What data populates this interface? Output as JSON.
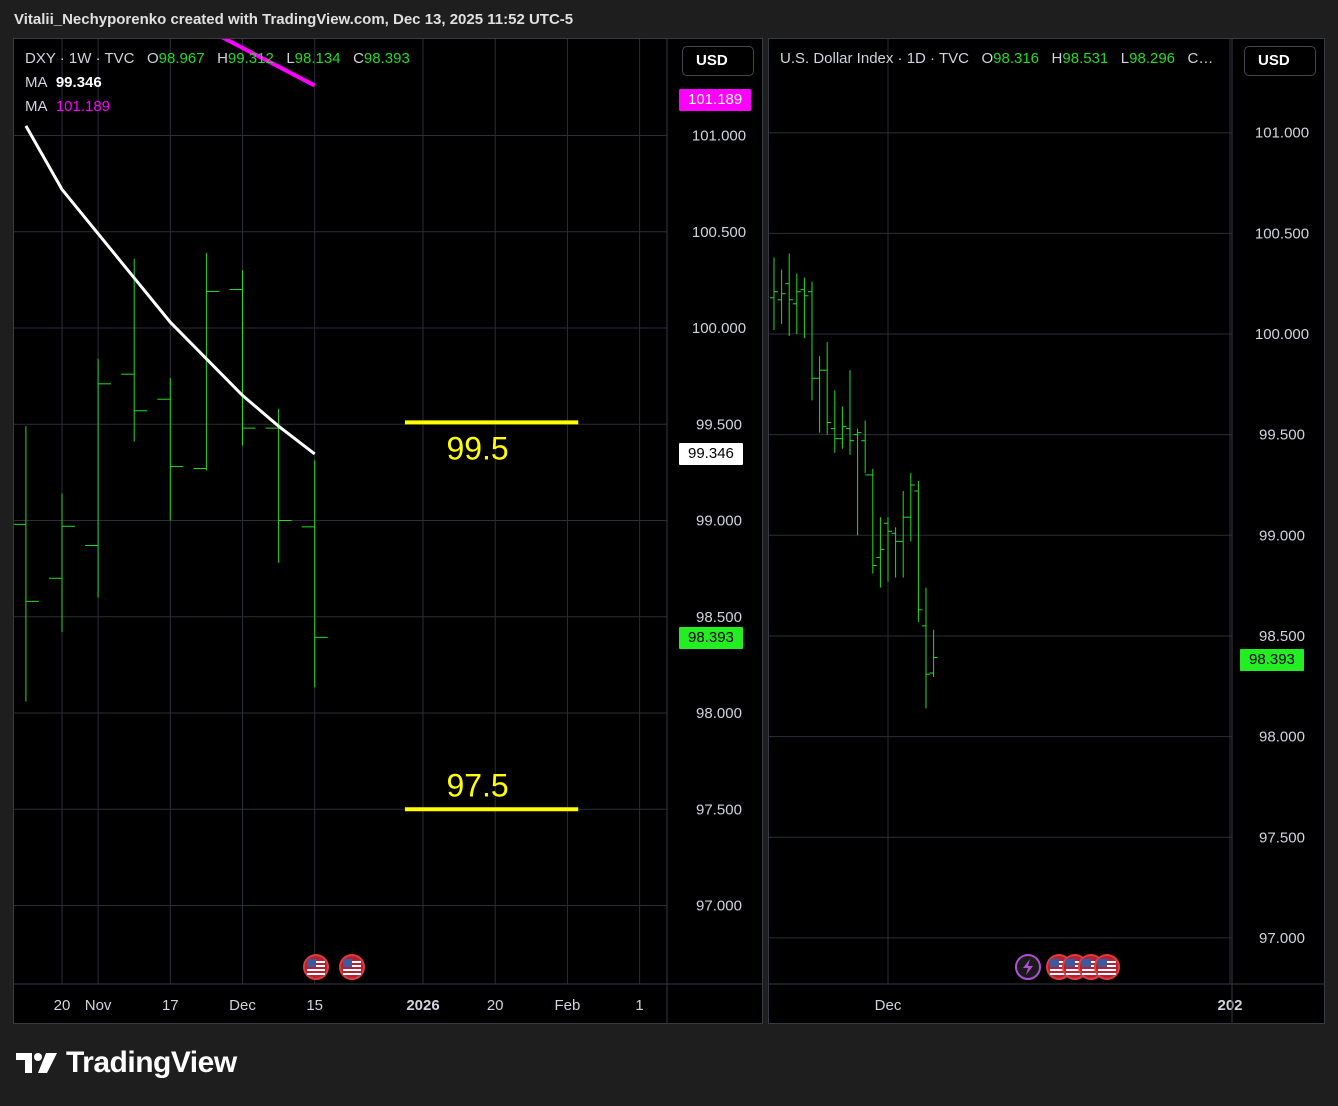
{
  "header": {
    "text": "Vitalii_Nechyporenko created with TradingView.com, Dec 13, 2025 11:52 UTC-5"
  },
  "brand": {
    "name": "TradingView",
    "icon": "tradingview-logo-icon"
  },
  "colors": {
    "up": "#22dd22",
    "ma_fast": "#ffffff",
    "ma_slow": "#ff00ff",
    "level": "#ffff00",
    "grid": "#2a2e39",
    "bg": "#000000"
  },
  "left": {
    "legend": {
      "symbol": "DXY · 1W · TVC",
      "o_label": "O",
      "o": "98.967",
      "h_label": "H",
      "h": "99.312",
      "l_label": "L",
      "l": "98.134",
      "c_label": "C",
      "c": "98.393"
    },
    "ma1": {
      "label": "MA",
      "value": "99.346",
      "color": "#ffffff"
    },
    "ma2": {
      "label": "MA",
      "value": "101.189",
      "color": "#ff00ff"
    },
    "currency": "USD",
    "tags": {
      "ma2": "101.189",
      "ma1": "99.346",
      "last": "98.393"
    },
    "level_labels": {
      "upper": "99.5",
      "lower": "97.5"
    },
    "event_icons": [
      "us-flag-icon",
      "us-flag-icon"
    ]
  },
  "right": {
    "legend": {
      "symbol": "U.S. Dollar Index · 1D · TVC",
      "o_label": "O",
      "o": "98.316",
      "h_label": "H",
      "h": "98.531",
      "l_label": "L",
      "l": "98.296",
      "c_label": "C…",
      "c": ""
    },
    "currency": "USD",
    "tags": {
      "last": "98.393"
    },
    "event_icons": [
      "lightning-icon",
      "us-flag-icon",
      "us-flag-icon",
      "us-flag-icon",
      "us-flag-icon"
    ]
  },
  "chart_data": [
    {
      "type": "ohlc",
      "title": "DXY · 1W · TVC",
      "ylim": [
        96.7,
        101.7
      ],
      "y_ticks": [
        "101.000",
        "100.500",
        "100.000",
        "99.500",
        "99.000",
        "98.500",
        "98.000",
        "97.500",
        "97.000"
      ],
      "y_tick_values": [
        101.0,
        100.5,
        100.0,
        99.5,
        99.0,
        98.5,
        98.0,
        97.5,
        97.0
      ],
      "x_ticks": [
        "20",
        "Nov",
        "17",
        "Dec",
        "15",
        "2026",
        "20",
        "Feb",
        "1"
      ],
      "x_tick_bold": [
        false,
        false,
        false,
        false,
        false,
        true,
        false,
        false,
        false
      ],
      "x_tick_week_index": [
        0,
        1,
        3,
        5,
        7,
        10,
        12,
        14,
        16
      ],
      "bars": [
        {
          "w": -1,
          "o": 98.98,
          "h": 99.49,
          "l": 98.06,
          "c": 98.58
        },
        {
          "w": 0,
          "o": 98.7,
          "h": 99.14,
          "l": 98.42,
          "c": 98.97
        },
        {
          "w": 1,
          "o": 98.87,
          "h": 99.84,
          "l": 98.6,
          "c": 99.71
        },
        {
          "w": 2,
          "o": 99.76,
          "h": 100.36,
          "l": 99.41,
          "c": 99.57
        },
        {
          "w": 3,
          "o": 99.63,
          "h": 99.74,
          "l": 99.0,
          "c": 99.28
        },
        {
          "w": 4,
          "o": 99.27,
          "h": 100.39,
          "l": 99.26,
          "c": 100.19
        },
        {
          "w": 5,
          "o": 100.2,
          "h": 100.3,
          "l": 99.39,
          "c": 99.48
        },
        {
          "w": 6,
          "o": 99.48,
          "h": 99.58,
          "l": 98.78,
          "c": 99.0
        },
        {
          "w": 7,
          "o": 98.967,
          "h": 99.312,
          "l": 98.134,
          "c": 98.393
        }
      ],
      "ma_fast": {
        "name": "MA",
        "w": [
          -1,
          0,
          1,
          2,
          3,
          4,
          5,
          6,
          7
        ],
        "values": [
          101.05,
          100.72,
          100.49,
          100.26,
          100.03,
          99.84,
          99.65,
          99.49,
          99.346
        ]
      },
      "ma_slow": {
        "name": "MA",
        "w": [
          2.7,
          7
        ],
        "values": [
          101.68,
          101.26
        ]
      },
      "levels": [
        {
          "label": "99.5",
          "value": 99.51,
          "w_start": 9.5,
          "w_end": 14.3
        },
        {
          "label": "97.5",
          "value": 97.5,
          "w_start": 9.5,
          "w_end": 14.3
        }
      ]
    },
    {
      "type": "ohlc",
      "title": "U.S. Dollar Index · 1D · TVC",
      "ylim": [
        96.7,
        101.7
      ],
      "y_ticks": [
        "101.000",
        "100.500",
        "100.000",
        "99.500",
        "99.000",
        "98.500",
        "98.000",
        "97.500",
        "97.000"
      ],
      "y_tick_values": [
        101.0,
        100.5,
        100.0,
        99.5,
        99.0,
        98.5,
        98.0,
        97.5,
        97.0
      ],
      "x_ticks": [
        "Dec",
        "202"
      ],
      "x_tick_bold": [
        false,
        true
      ],
      "x_tick_day_index": [
        15,
        60
      ],
      "bars": [
        {
          "d": 0,
          "o": 100.18,
          "h": 100.38,
          "l": 100.02,
          "c": 100.21
        },
        {
          "d": 1,
          "o": 100.17,
          "h": 100.32,
          "l": 100.05,
          "c": 100.2
        },
        {
          "d": 2,
          "o": 100.25,
          "h": 100.4,
          "l": 99.99,
          "c": 100.17
        },
        {
          "d": 3,
          "o": 100.15,
          "h": 100.3,
          "l": 100.0,
          "c": 100.21
        },
        {
          "d": 4,
          "o": 100.22,
          "h": 100.28,
          "l": 99.98,
          "c": 100.19
        },
        {
          "d": 5,
          "o": 100.21,
          "h": 100.26,
          "l": 99.67,
          "c": 99.78
        },
        {
          "d": 6,
          "o": 99.78,
          "h": 99.89,
          "l": 99.51,
          "c": 99.82
        },
        {
          "d": 7,
          "o": 99.82,
          "h": 99.96,
          "l": 99.5,
          "c": 99.56
        },
        {
          "d": 8,
          "o": 99.53,
          "h": 99.72,
          "l": 99.41,
          "c": 99.48
        },
        {
          "d": 9,
          "o": 99.48,
          "h": 99.64,
          "l": 99.43,
          "c": 99.54
        },
        {
          "d": 10,
          "o": 99.53,
          "h": 99.82,
          "l": 99.4,
          "c": 99.47
        },
        {
          "d": 11,
          "o": 99.5,
          "h": 99.53,
          "l": 99.0,
          "c": 99.51
        },
        {
          "d": 12,
          "o": 99.47,
          "h": 99.57,
          "l": 99.31,
          "c": 99.3
        },
        {
          "d": 13,
          "o": 99.3,
          "h": 99.33,
          "l": 98.81,
          "c": 98.85
        },
        {
          "d": 14,
          "o": 98.89,
          "h": 99.09,
          "l": 98.74,
          "c": 98.93
        },
        {
          "d": 15,
          "o": 99.06,
          "h": 99.09,
          "l": 98.77,
          "c": 99.02
        },
        {
          "d": 16,
          "o": 99.01,
          "h": 99.04,
          "l": 98.79,
          "c": 98.97
        },
        {
          "d": 17,
          "o": 98.97,
          "h": 99.22,
          "l": 98.79,
          "c": 99.09
        },
        {
          "d": 18,
          "o": 99.09,
          "h": 99.31,
          "l": 98.97,
          "c": 99.25
        },
        {
          "d": 19,
          "o": 99.22,
          "h": 99.27,
          "l": 98.57,
          "c": 98.63
        },
        {
          "d": 20,
          "o": 98.55,
          "h": 98.74,
          "l": 98.14,
          "c": 98.31
        },
        {
          "d": 21,
          "o": 98.316,
          "h": 98.531,
          "l": 98.296,
          "c": 98.393
        }
      ]
    }
  ]
}
